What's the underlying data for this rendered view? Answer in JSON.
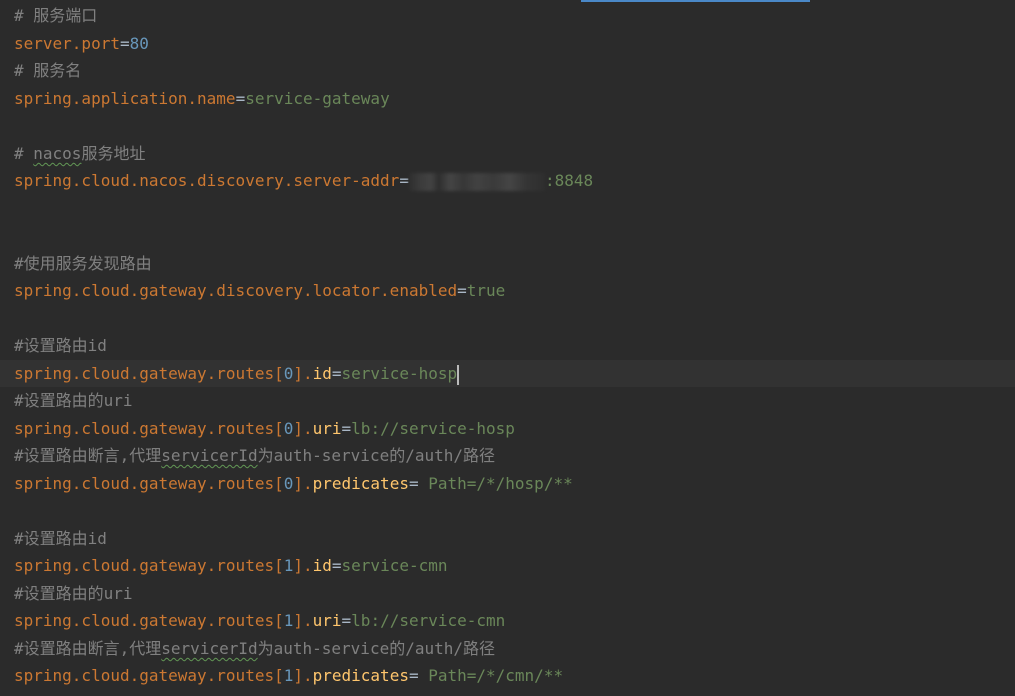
{
  "editor": {
    "comment_service_port": "# 服务端口",
    "server_port_key": "server.port",
    "server_port_value": "80",
    "comment_service_name": "# 服务名",
    "app_name_key": "spring.application.name",
    "app_name_value": "service-gateway",
    "nacos_comment_prefix": "# ",
    "nacos_word": "nacos",
    "nacos_comment_suffix": "服务地址",
    "nacos_addr_key": "spring.cloud.nacos.discovery.server-addr",
    "nacos_addr_port": ":8848",
    "comment_discovery": "#使用服务发现路由",
    "discovery_key": "spring.cloud.gateway.discovery.locator.enabled",
    "discovery_value": "true",
    "equals": "=",
    "route_prefix": "spring.cloud.gateway.routes[",
    "route_mid": "].",
    "route_spacer": "= ",
    "comment_route_id": "#设置路由id",
    "comment_route_uri": "#设置路由的uri",
    "comment_pred_prefix": "#设置路由断言,代理",
    "comment_pred_word": "servicerId",
    "comment_pred_suffix": "为auth-service的/auth/路径",
    "id_prop": "id",
    "uri_prop": "uri",
    "predicates_prop": "predicates",
    "route0_index": "0",
    "route0_id": "service-hosp",
    "route0_uri": "lb://service-hosp",
    "route0_predicates": "Path=/*/hosp/**",
    "route1_index": "1",
    "route1_id": "service-cmn",
    "route1_uri": "lb://service-cmn",
    "route1_predicates": "Path=/*/cmn/**"
  },
  "colors": {
    "background": "#2b2b2b",
    "current_line": "#323232",
    "comment": "#808080",
    "key": "#cc7832",
    "value": "#6a8759",
    "number": "#6897bb",
    "property": "#ffc66d"
  }
}
